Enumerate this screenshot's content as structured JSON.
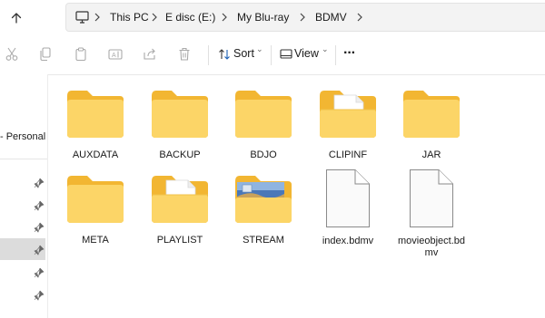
{
  "nav": {
    "up_icon": "arrow-up-icon"
  },
  "breadcrumb": {
    "root_icon": "monitor-icon",
    "items": [
      "This PC",
      "E disc (E:)",
      "My Blu-ray",
      "BDMV"
    ]
  },
  "toolbar": {
    "actions": [
      "cut-icon",
      "copy-icon",
      "paste-icon",
      "rename-icon",
      "share-icon",
      "delete-icon"
    ],
    "sort_label": "Sort",
    "view_label": "View",
    "more_label": "···"
  },
  "sidebar": {
    "label": "- Personal",
    "pins": 6,
    "selected_index": 3
  },
  "files": [
    {
      "name": "AUXDATA",
      "type": "folder"
    },
    {
      "name": "BACKUP",
      "type": "folder"
    },
    {
      "name": "BDJO",
      "type": "folder"
    },
    {
      "name": "CLIPINF",
      "type": "folder-with-doc"
    },
    {
      "name": "JAR",
      "type": "folder"
    },
    {
      "name": "META",
      "type": "folder"
    },
    {
      "name": "PLAYLIST",
      "type": "folder-with-doc"
    },
    {
      "name": "STREAM",
      "type": "folder-with-image"
    },
    {
      "name": "index.bdmv",
      "type": "file"
    },
    {
      "name": "movieobject.bdmv",
      "type": "file",
      "display_lines": [
        "movieobject.bd",
        "mv"
      ]
    }
  ],
  "colors": {
    "folder_back": "#F2B632",
    "folder_front": "#FCD567",
    "file_fill": "#FAFAFA",
    "file_stroke": "#8A8A8A",
    "selected_bg": "#DCDCDC"
  }
}
